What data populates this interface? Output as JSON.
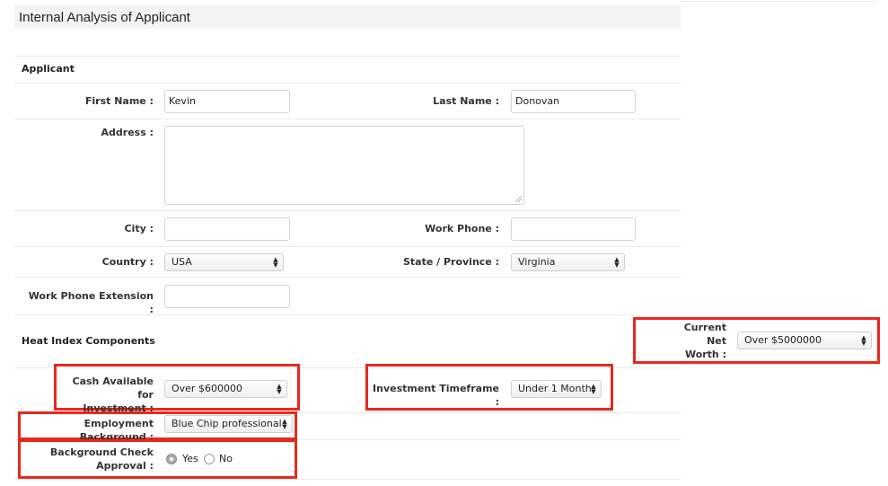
{
  "page_title": "Internal Analysis of Applicant",
  "applicant_section": {
    "heading": "Applicant",
    "first_name": {
      "label": "First Name :",
      "value": "Kevin"
    },
    "last_name": {
      "label": "Last Name :",
      "value": "Donovan"
    },
    "address": {
      "label": "Address :",
      "value": ""
    },
    "city": {
      "label": "City :",
      "value": ""
    },
    "work_phone": {
      "label": "Work Phone :",
      "value": ""
    },
    "country": {
      "label": "Country :",
      "value": "USA"
    },
    "state": {
      "label": "State / Province :",
      "value": "Virginia"
    },
    "work_phone_ext": {
      "label": "Work Phone Extension :",
      "value": ""
    }
  },
  "heat_index": {
    "heading": "Heat Index Components",
    "net_worth": {
      "label_lines": [
        "Current",
        "Net",
        "Worth :"
      ],
      "value": "Over $5000000"
    },
    "cash_available": {
      "label_lines": [
        "Cash Available for",
        "Investment :"
      ],
      "value": "Over $600000"
    },
    "timeframe": {
      "label": "Investment Timeframe :",
      "value": "Under 1 Month"
    },
    "employment": {
      "label": "Employment Background :",
      "value": "Blue Chip professional"
    },
    "background_check": {
      "label_lines": [
        "Background Check",
        "Approval :"
      ],
      "options": [
        "Yes",
        "No"
      ],
      "selected": "Yes"
    }
  },
  "colors": {
    "highlight": "#e8281c",
    "title_bg": "#f4f4f4"
  }
}
